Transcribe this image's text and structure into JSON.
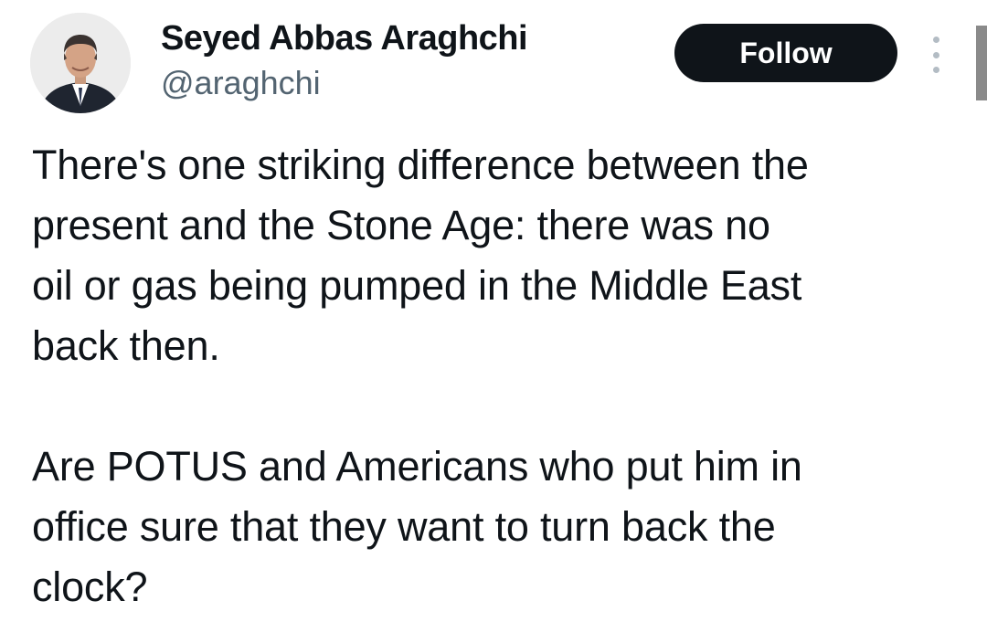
{
  "author": {
    "display_name": "Seyed Abbas Araghchi",
    "handle": "@araghchi",
    "avatar_icon": "profile-photo"
  },
  "actions": {
    "follow_label": "Follow",
    "more_icon": "vertical-ellipsis-icon"
  },
  "tweet": {
    "paragraphs": [
      "There's one striking difference between the\npresent and the Stone Age: there was no\noil or gas being pumped in the Middle East\nback then.",
      "Are POTUS and Americans who put him in\noffice sure that they want to turn back the\nclock?"
    ]
  },
  "colors": {
    "text": "#0f1419",
    "secondary_text": "#536471",
    "follow_bg": "#0f1419",
    "follow_text": "#ffffff"
  }
}
